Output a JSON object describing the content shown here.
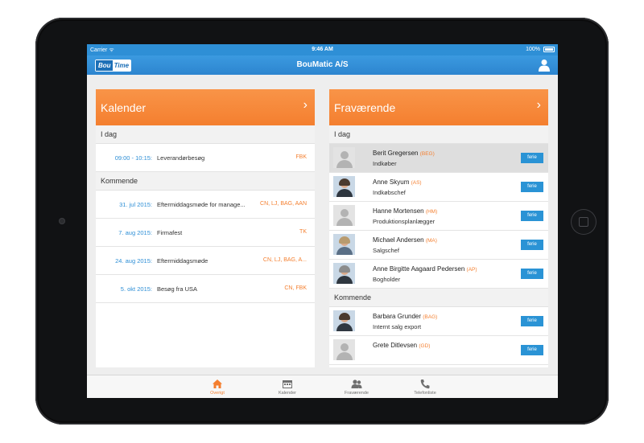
{
  "statusbar": {
    "carrier": "Carrier ᯤ",
    "time": "9:46 AM",
    "battery": "100%"
  },
  "navbar": {
    "logo_a": "Bou",
    "logo_b": "Time",
    "title": "BouMatic A/S"
  },
  "kalender": {
    "title": "Kalender",
    "today_label": "I dag",
    "today": [
      {
        "date": "09:00 - 10:15:",
        "title": "Leverandørbesøg",
        "who": "FBK"
      }
    ],
    "upcoming_label": "Kommende",
    "upcoming": [
      {
        "date": "31. jul 2015:",
        "title": "Eftermiddagsmøde for manage...",
        "who": "CN, LJ, BAG, AAN"
      },
      {
        "date": "7. aug 2015:",
        "title": "Firmafest",
        "who": "TK"
      },
      {
        "date": "24. aug 2015:",
        "title": "Eftermiddagsmøde",
        "who": "CN, LJ, BAG, A..."
      },
      {
        "date": "5. okt 2015:",
        "title": "Besøg fra USA",
        "who": "CN, FBK"
      }
    ]
  },
  "fravaerende": {
    "title": "Fraværende",
    "today_label": "I dag",
    "today": [
      {
        "name": "Berit Gregersen",
        "initials": "(BEG)",
        "role": "Indkøber",
        "badge": "ferie"
      },
      {
        "name": "Anne Skyum",
        "initials": "(AS)",
        "role": "Indkøbschef",
        "badge": "ferie"
      },
      {
        "name": "Hanne Mortensen",
        "initials": "(HM)",
        "role": "Produktionsplanlægger",
        "badge": "ferie"
      },
      {
        "name": "Michael Andersen",
        "initials": "(MA)",
        "role": "Salgschef",
        "badge": "ferie"
      },
      {
        "name": "Anne Birgitte Aagaard Pedersen",
        "initials": "(AP)",
        "role": "Bogholder",
        "badge": "ferie"
      }
    ],
    "upcoming_label": "Kommende",
    "upcoming": [
      {
        "name": "Barbara Grunder",
        "initials": "(BAG)",
        "role": "Internt salg export",
        "badge": "ferie"
      },
      {
        "name": "Grete Ditlevsen",
        "initials": "(GD)",
        "role": "",
        "badge": "ferie"
      }
    ]
  },
  "tabbar": [
    {
      "label": "Overigt",
      "icon": "home-icon"
    },
    {
      "label": "Kalender",
      "icon": "calendar-icon"
    },
    {
      "label": "Fraværende",
      "icon": "people-icon"
    },
    {
      "label": "Telefonliste",
      "icon": "phone-icon"
    }
  ],
  "colors": {
    "accent": "#f47f2f",
    "blue": "#2e8fd6"
  }
}
